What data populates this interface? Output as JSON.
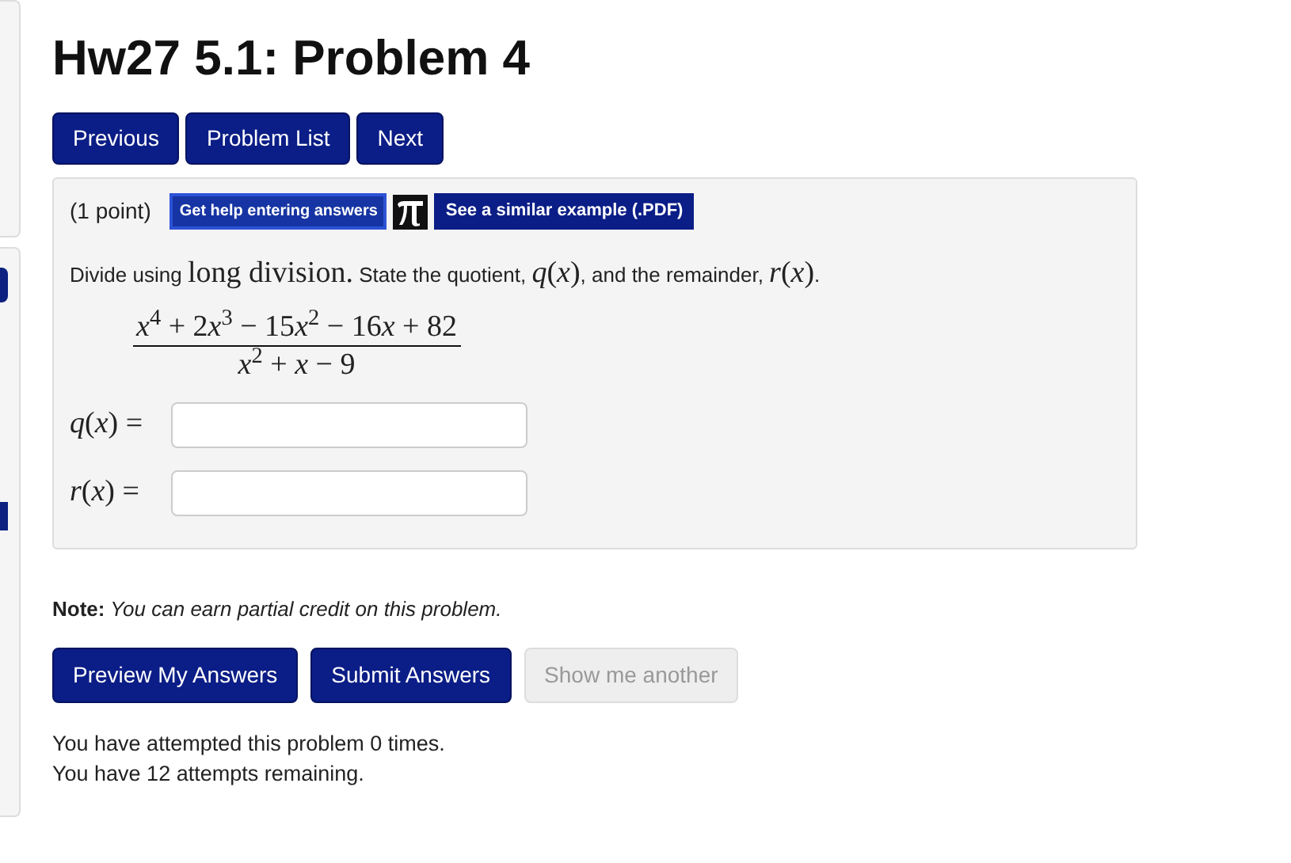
{
  "title": "Hw27 5.1: Problem 4",
  "nav_buttons": [
    "Previous",
    "Problem List",
    "Next"
  ],
  "problem": {
    "points": "(1 point)",
    "help_links": [
      {
        "kind": "help",
        "label": "Get help entering answers"
      },
      {
        "kind": "pi"
      },
      {
        "kind": "example",
        "label": "See a similar example (.PDF)"
      }
    ],
    "statement": [
      {
        "kind": "text",
        "text": "Divide using "
      },
      {
        "kind": "math",
        "text": "long division."
      },
      {
        "kind": "text",
        "text": " State the quotient, "
      },
      {
        "kind": "math",
        "text": "*q*(*x*)"
      },
      {
        "kind": "text",
        "text": ", and the remainder, "
      },
      {
        "kind": "math",
        "text": "*r*(*x*)"
      },
      {
        "kind": "text",
        "text": "."
      }
    ],
    "numerator": [
      {
        "kind": "var",
        "text": "x"
      },
      {
        "kind": "sup",
        "text": "4"
      },
      {
        "kind": "num",
        "text": " + 2"
      },
      {
        "kind": "var",
        "text": "x"
      },
      {
        "kind": "sup",
        "text": "3"
      },
      {
        "kind": "num",
        "text": " − 15"
      },
      {
        "kind": "var",
        "text": "x"
      },
      {
        "kind": "sup",
        "text": "2"
      },
      {
        "kind": "num",
        "text": " − 16"
      },
      {
        "kind": "var",
        "text": "x"
      },
      {
        "kind": "num",
        "text": " + 82"
      }
    ],
    "denominator": [
      {
        "kind": "var",
        "text": "x"
      },
      {
        "kind": "sup",
        "text": "2"
      },
      {
        "kind": "num",
        "text": " + "
      },
      {
        "kind": "var",
        "text": "x"
      },
      {
        "kind": "num",
        "text": " − 9"
      }
    ],
    "answers": [
      {
        "label": "*q*(*x*) ="
      },
      {
        "label": "*r*(*x*) ="
      }
    ]
  },
  "note": {
    "label": "Note:",
    "text": "You can earn partial credit on this problem."
  },
  "actions": [
    {
      "label": "Preview My Answers",
      "disabled": false
    },
    {
      "label": "Submit Answers",
      "disabled": false
    },
    {
      "label": "Show me another",
      "disabled": true
    }
  ],
  "attempts": [
    "You have attempted this problem 0 times.",
    "You have 12 attempts remaining."
  ]
}
